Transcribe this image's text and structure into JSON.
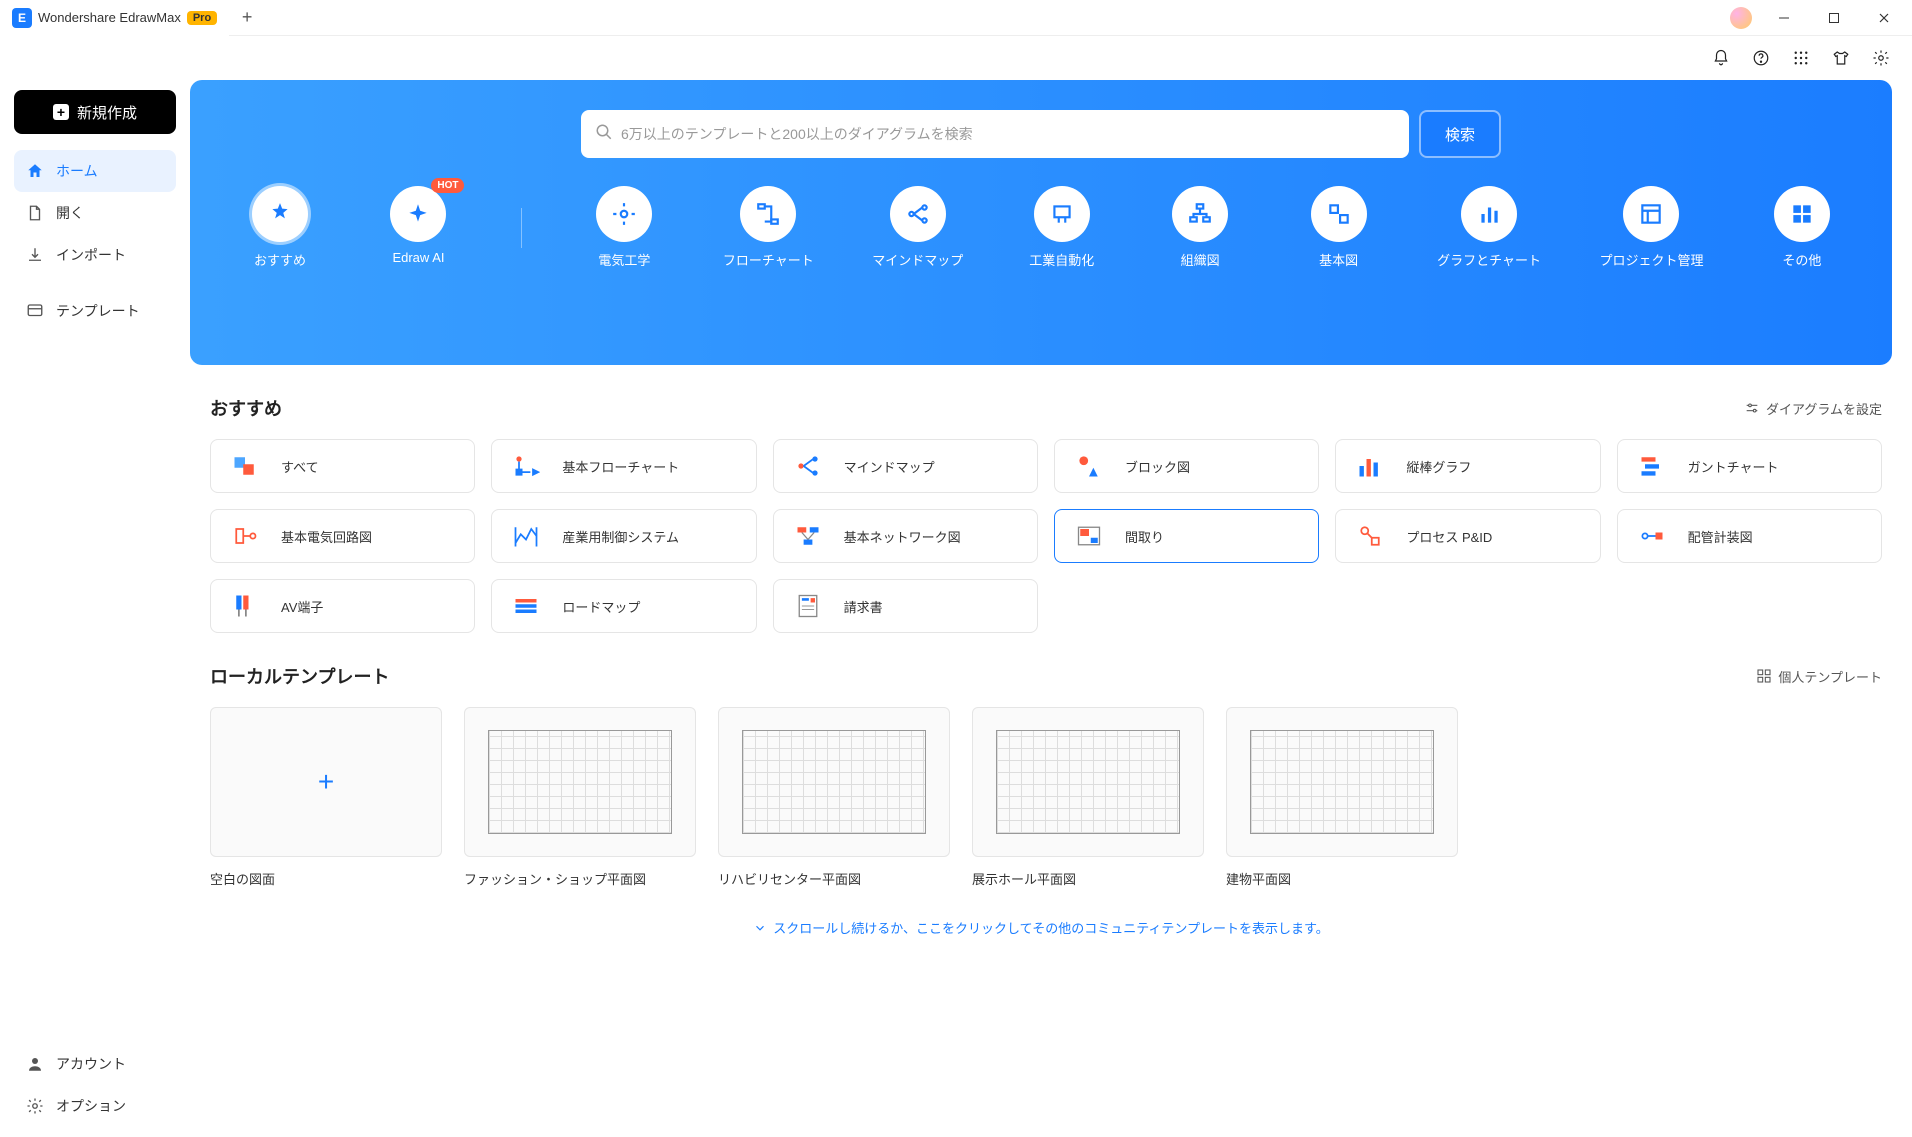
{
  "titlebar": {
    "app_name": "Wondershare EdrawMax",
    "pro_badge": "Pro"
  },
  "sidebar": {
    "new_label": "新規作成",
    "nav": [
      {
        "label": "ホーム",
        "active": true
      },
      {
        "label": "開く",
        "active": false
      },
      {
        "label": "インポート",
        "active": false
      },
      {
        "label": "テンプレート",
        "active": false
      }
    ],
    "footer": [
      {
        "label": "アカウント"
      },
      {
        "label": "オプション"
      }
    ]
  },
  "hero": {
    "search_placeholder": "6万以上のテンプレートと200以上のダイアグラムを検索",
    "search_btn": "検索",
    "categories": [
      {
        "label": "おすすめ",
        "active": true,
        "badge": null
      },
      {
        "label": "Edraw AI",
        "active": false,
        "badge": "HOT"
      },
      {
        "label": "電気工学",
        "active": false,
        "badge": null
      },
      {
        "label": "フローチャート",
        "active": false,
        "badge": null
      },
      {
        "label": "マインドマップ",
        "active": false,
        "badge": null
      },
      {
        "label": "工業自動化",
        "active": false,
        "badge": null
      },
      {
        "label": "組織図",
        "active": false,
        "badge": null
      },
      {
        "label": "基本図",
        "active": false,
        "badge": null
      },
      {
        "label": "グラフとチャート",
        "active": false,
        "badge": null
      },
      {
        "label": "プロジェクト管理",
        "active": false,
        "badge": null
      },
      {
        "label": "その他",
        "active": false,
        "badge": null
      }
    ]
  },
  "recommend": {
    "title": "おすすめ",
    "action": "ダイアグラムを設定",
    "tiles": [
      {
        "label": "すべて"
      },
      {
        "label": "基本フローチャート"
      },
      {
        "label": "マインドマップ"
      },
      {
        "label": "ブロック図"
      },
      {
        "label": "縦棒グラフ"
      },
      {
        "label": "ガントチャート"
      },
      {
        "label": "基本電気回路図"
      },
      {
        "label": "産業用制御システム"
      },
      {
        "label": "基本ネットワーク図"
      },
      {
        "label": "間取り",
        "active": true
      },
      {
        "label": "プロセス P&ID"
      },
      {
        "label": "配管計装図"
      },
      {
        "label": "AV端子"
      },
      {
        "label": "ロードマップ"
      },
      {
        "label": "請求書"
      }
    ]
  },
  "local": {
    "title": "ローカルテンプレート",
    "action": "個人テンプレート",
    "templates": [
      {
        "label": "空白の図面",
        "blank": true
      },
      {
        "label": "ファッション・ショップ平面図"
      },
      {
        "label": "リハビリセンター平面図"
      },
      {
        "label": "展示ホール平面図"
      },
      {
        "label": "建物平面図"
      }
    ]
  },
  "scroll_hint": "スクロールし続けるか、ここをクリックしてその他のコミュニティテンプレートを表示します。"
}
